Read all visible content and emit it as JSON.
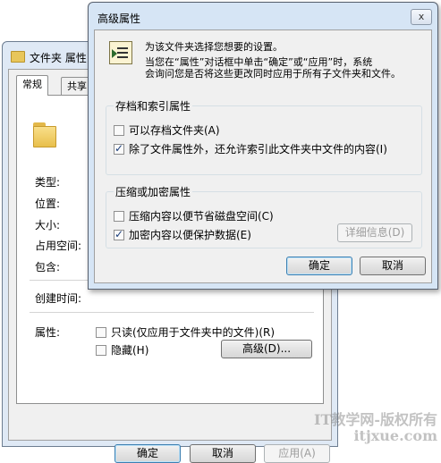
{
  "back_window": {
    "title": "文件夹 属性",
    "tabs": [
      "常规",
      "共享"
    ],
    "fields": {
      "type_label": "类型:",
      "location_label": "位置:",
      "size_label": "大小:",
      "size_on_disk_label": "占用空间:",
      "contains_label": "包含:",
      "created_label": "创建时间:",
      "attributes_label": "属性:"
    },
    "attributes": {
      "readonly_label": "只读(仅应用于文件夹中的文件)(R)",
      "readonly_checked": false,
      "hidden_label": "隐藏(H)",
      "hidden_checked": false,
      "advanced_button": "高级(D)..."
    },
    "buttons": {
      "ok": "确定",
      "cancel": "取消",
      "apply": "应用(A)"
    }
  },
  "dialog": {
    "title": "高级属性",
    "close_label": "x",
    "intro_line1": "为该文件夹选择您想要的设置。",
    "intro_line2": "当您在“属性”对话框中单击“确定”或“应用”时，系统",
    "intro_line3": "会询问您是否将这些更改同时应用于所有子文件夹和文件。",
    "archive_group": {
      "title": "存档和索引属性",
      "archive_label": "可以存档文件夹(A)",
      "archive_checked": false,
      "index_label": "除了文件属性外，还允许索引此文件夹中文件的内容(I)",
      "index_checked": true
    },
    "compress_group": {
      "title": "压缩或加密属性",
      "compress_label": "压缩内容以便节省磁盘空间(C)",
      "compress_checked": false,
      "encrypt_label": "加密内容以便保护数据(E)",
      "encrypt_checked": true,
      "details_button": "详细信息(D)"
    },
    "buttons": {
      "ok": "确定",
      "cancel": "取消"
    }
  },
  "watermark": {
    "line1": "IT教学网-版权所有",
    "line2": "itjxue.com"
  }
}
